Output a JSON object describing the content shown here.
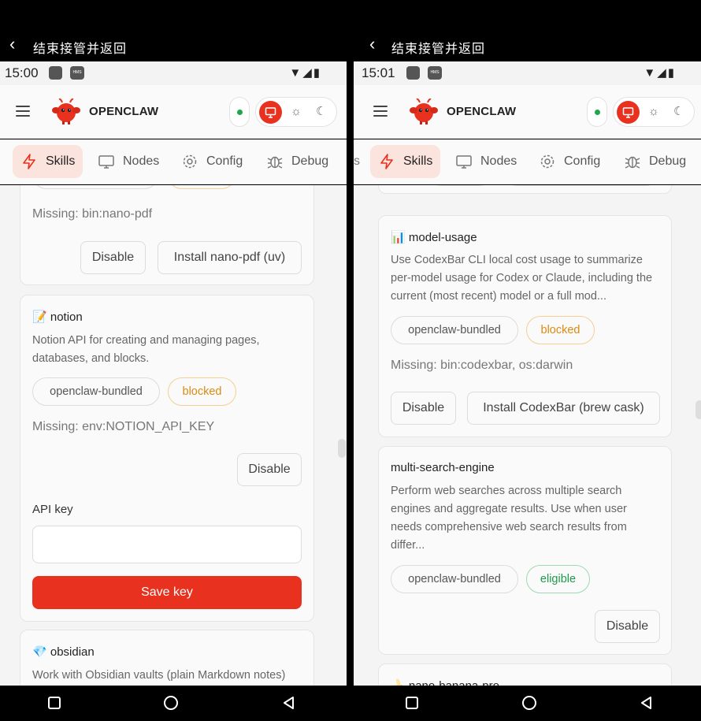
{
  "topbar": {
    "title": "结束接管并返回"
  },
  "left": {
    "time": "15:00",
    "cards": {
      "prev": {
        "missing": "Missing: bin:nano-pdf",
        "disable": "Disable",
        "install": "Install nano-pdf (uv)"
      },
      "notion": {
        "name": "notion",
        "emoji": "📝",
        "description": "Notion API for creating and managing pages, databases, and blocks.",
        "chip_source": "openclaw-bundled",
        "chip_status": "blocked",
        "missing": "Missing: env:NOTION_API_KEY",
        "disable": "Disable",
        "api_label": "API key",
        "api_value": "",
        "save": "Save key"
      },
      "obsidian": {
        "name": "obsidian",
        "emoji": "💎",
        "description": "Work with Obsidian vaults (plain Markdown notes)"
      }
    }
  },
  "right": {
    "time": "15:01",
    "tab_edge": "s",
    "cards": {
      "model_usage": {
        "name": "model-usage",
        "emoji": "📊",
        "description": "Use CodexBar CLI local cost usage to summarize per-model usage for Codex or Claude, including the current (most recent) model or a full mod...",
        "chip_source": "openclaw-bundled",
        "chip_status": "blocked",
        "missing": "Missing: bin:codexbar, os:darwin",
        "disable": "Disable",
        "install": "Install CodexBar (brew cask)"
      },
      "multi_search": {
        "name": "multi-search-engine",
        "description": "Perform web searches across multiple search engines and aggregate results. Use when user needs comprehensive web search results from differ...",
        "chip_source": "openclaw-bundled",
        "chip_status": "eligible",
        "disable": "Disable"
      },
      "nano_banana": {
        "name": "nano-banana-pro",
        "emoji": "🍌"
      }
    }
  },
  "header": {
    "brand": "OPENCLAW"
  },
  "tabs": {
    "skills": "Skills",
    "nodes": "Nodes",
    "config": "Config",
    "debug": "Debug"
  },
  "colors": {
    "accent": "#e8311f",
    "active_tab_bg": "#fbe3de",
    "blocked": "#dc8a10",
    "eligible": "#1e9a4a",
    "online": "#1fa84b"
  },
  "icons": [
    "back-chevron-icon",
    "menu-icon",
    "lobster-logo-icon",
    "monitor-icon",
    "sun-icon",
    "moon-icon",
    "lightning-icon",
    "gear-icon",
    "bug-icon",
    "square-icon",
    "circle-icon",
    "triangle-back-icon",
    "wifi-icon",
    "signal-icon",
    "battery-icon"
  ]
}
